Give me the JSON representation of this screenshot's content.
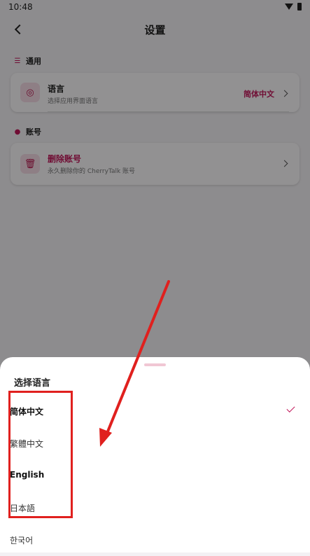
{
  "status_bar": {
    "time": "10:48"
  },
  "header": {
    "title": "设置"
  },
  "sections": [
    {
      "title": "通用",
      "icon": "sliders-icon"
    },
    {
      "title": "账号",
      "icon": "person-icon"
    }
  ],
  "language_row": {
    "title": "语言",
    "subtitle": "选择应用界面语言",
    "value": "简体中文",
    "icon": "globe-icon"
  },
  "delete_row": {
    "title": "删除账号",
    "subtitle": "永久删除你的 CherryTalk 账号",
    "icon": "trash-icon"
  },
  "sheet": {
    "title": "选择语言",
    "options": [
      {
        "label": "简体中文",
        "selected": true
      },
      {
        "label": "繁體中文",
        "selected": false
      },
      {
        "label": "English",
        "selected": false
      },
      {
        "label": "日本語",
        "selected": false
      },
      {
        "label": "한국어",
        "selected": false
      }
    ]
  },
  "colors": {
    "accent": "#c2185b",
    "annotation": "#e0201e"
  }
}
